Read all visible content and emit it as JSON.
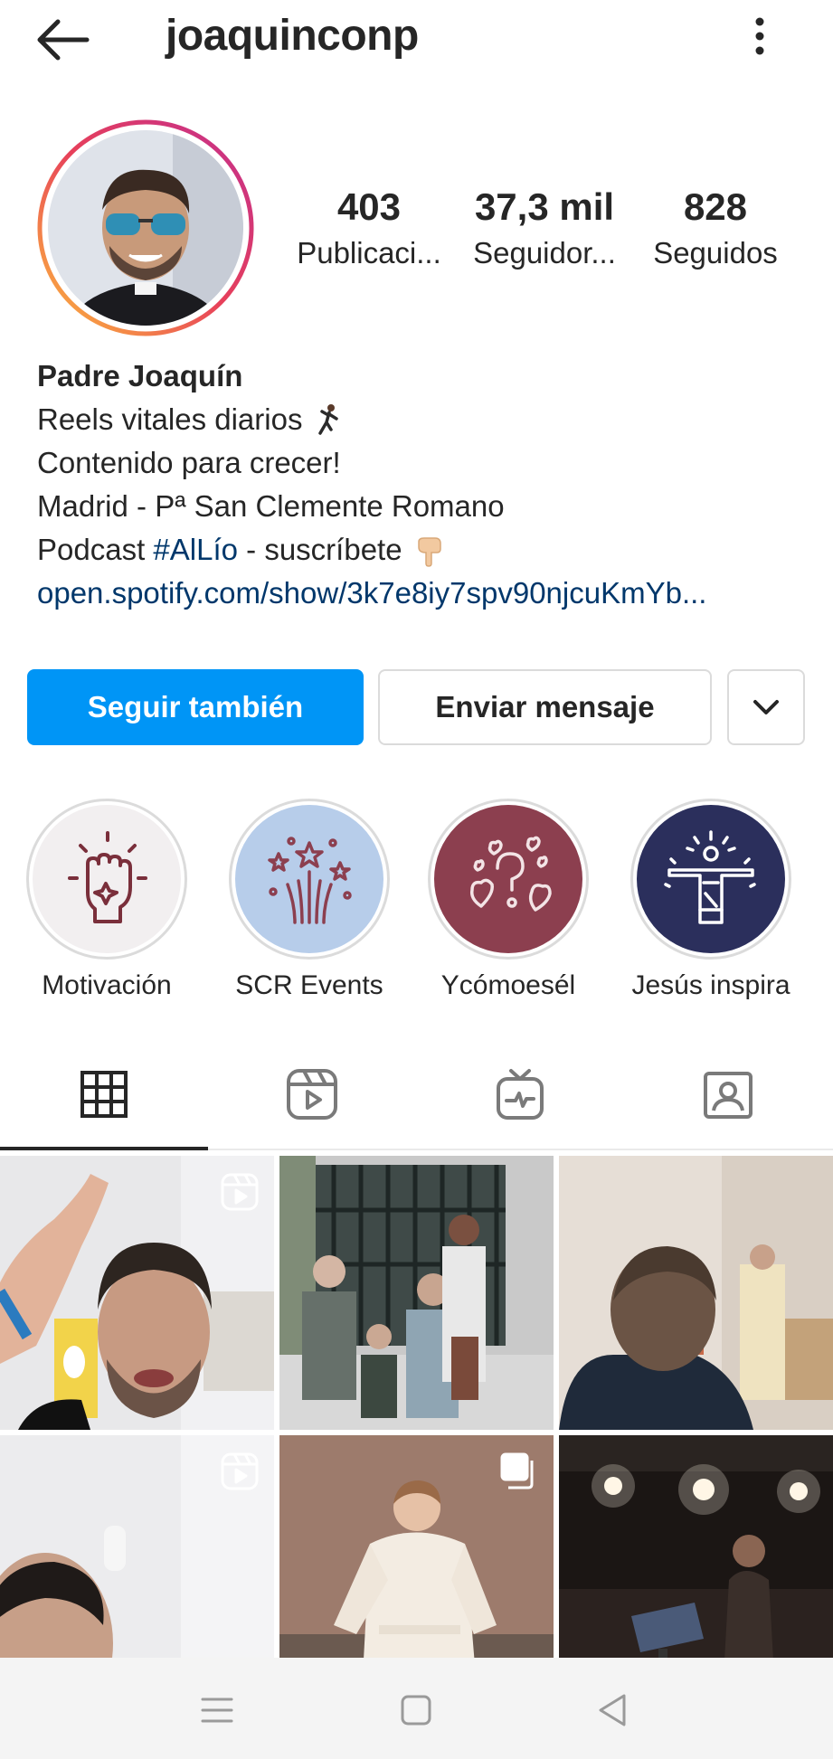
{
  "header": {
    "username": "joaquinconp",
    "back_icon": "arrow-left-icon",
    "more_icon": "more-vertical-icon"
  },
  "profile": {
    "avatar_icon": "profile-avatar",
    "stats": [
      {
        "value": "403",
        "label": "Publicaci..."
      },
      {
        "value": "37,3 mil",
        "label": "Seguidor..."
      },
      {
        "value": "828",
        "label": "Seguidos"
      }
    ],
    "name": "Padre Joaquín",
    "bio_line_1": "Reels vitales diarios",
    "bio_line_2": "Contenido para crecer!",
    "bio_line_3": "Madrid - Pª San Clemente Romano",
    "bio_line_4_prefix": "Podcast ",
    "bio_hashtag": "#AlLío",
    "bio_line_4_suffix": " - suscríbete",
    "link": "open.spotify.com/show/3k7e8iy7spv90njcuKmYb..."
  },
  "actions": {
    "follow_label": "Seguir también",
    "message_label": "Enviar mensaje",
    "dropdown_icon": "chevron-down-icon"
  },
  "highlights": [
    {
      "label": "Motivación",
      "icon": "raised-fist-icon",
      "color": "#f2eff0"
    },
    {
      "label": "SCR Events",
      "icon": "fireworks-icon",
      "color": "#b7cdea"
    },
    {
      "label": "Ycómoesél",
      "icon": "hearts-question-icon",
      "color": "#8c3f4f"
    },
    {
      "label": "Jesús inspira",
      "icon": "christ-statue-icon",
      "color": "#2b2f5c"
    }
  ],
  "tabs": [
    {
      "name": "posts",
      "icon": "grid-icon",
      "active": true
    },
    {
      "name": "reels",
      "icon": "reels-icon",
      "active": false
    },
    {
      "name": "igtv",
      "icon": "igtv-icon",
      "active": false
    },
    {
      "name": "tagged",
      "icon": "tagged-icon",
      "active": false
    }
  ],
  "grid": [
    {
      "badge": "reels-badge-icon"
    },
    {
      "badge": ""
    },
    {
      "badge": ""
    },
    {
      "badge": "reels-badge-icon"
    },
    {
      "badge": "carousel-badge-icon"
    },
    {
      "badge": ""
    }
  ],
  "system_nav": {
    "menu_icon": "menu-icon",
    "home_icon": "home-square-icon",
    "back_icon": "back-triangle-icon"
  },
  "colors": {
    "primary_blue": "#0095f6",
    "link_blue": "#00376b",
    "text": "#262626",
    "border": "#dbdbdb"
  }
}
